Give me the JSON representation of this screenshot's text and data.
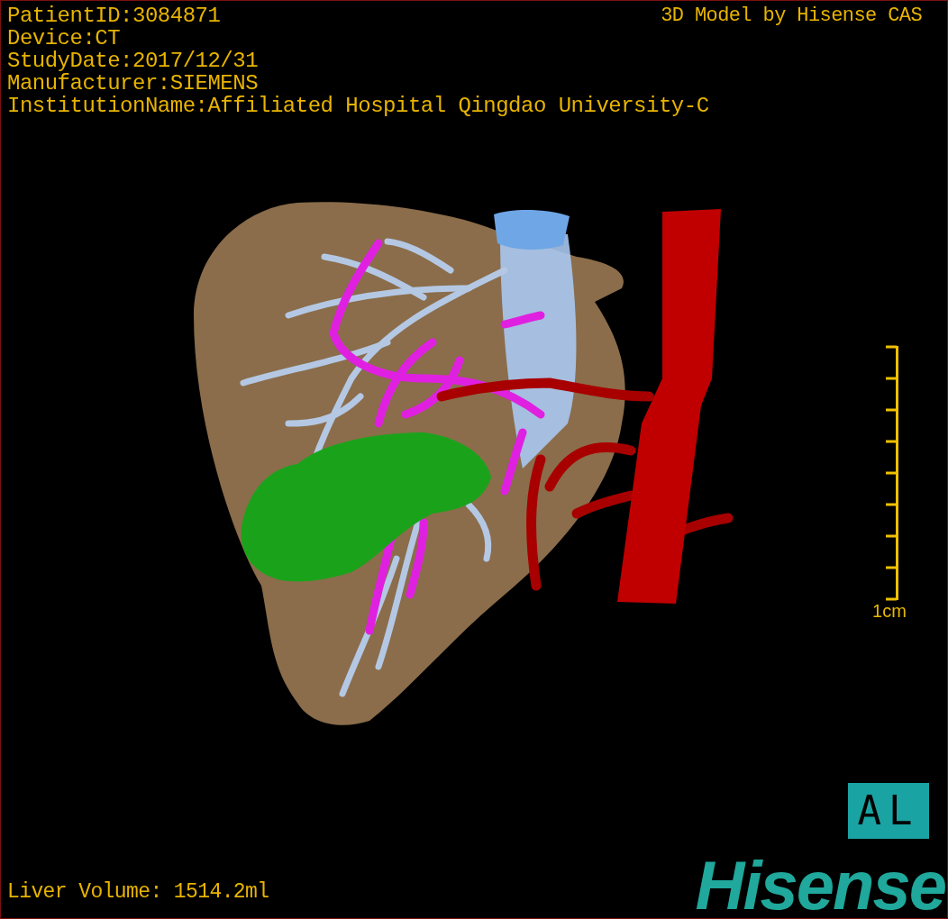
{
  "info_lines": [
    "PatientID:3084871",
    "Device:CT",
    "StudyDate:2017/12/31",
    "Manufacturer:SIEMENS",
    "InstitutionName:Affiliated Hospital Qingdao University-C"
  ],
  "title": "3D Model by Hisense CAS",
  "scale_bar": {
    "caption": "1cm"
  },
  "orientation": "AL",
  "liver_volume": "Liver Volume: 1514.2ml",
  "logo": "Hisense"
}
